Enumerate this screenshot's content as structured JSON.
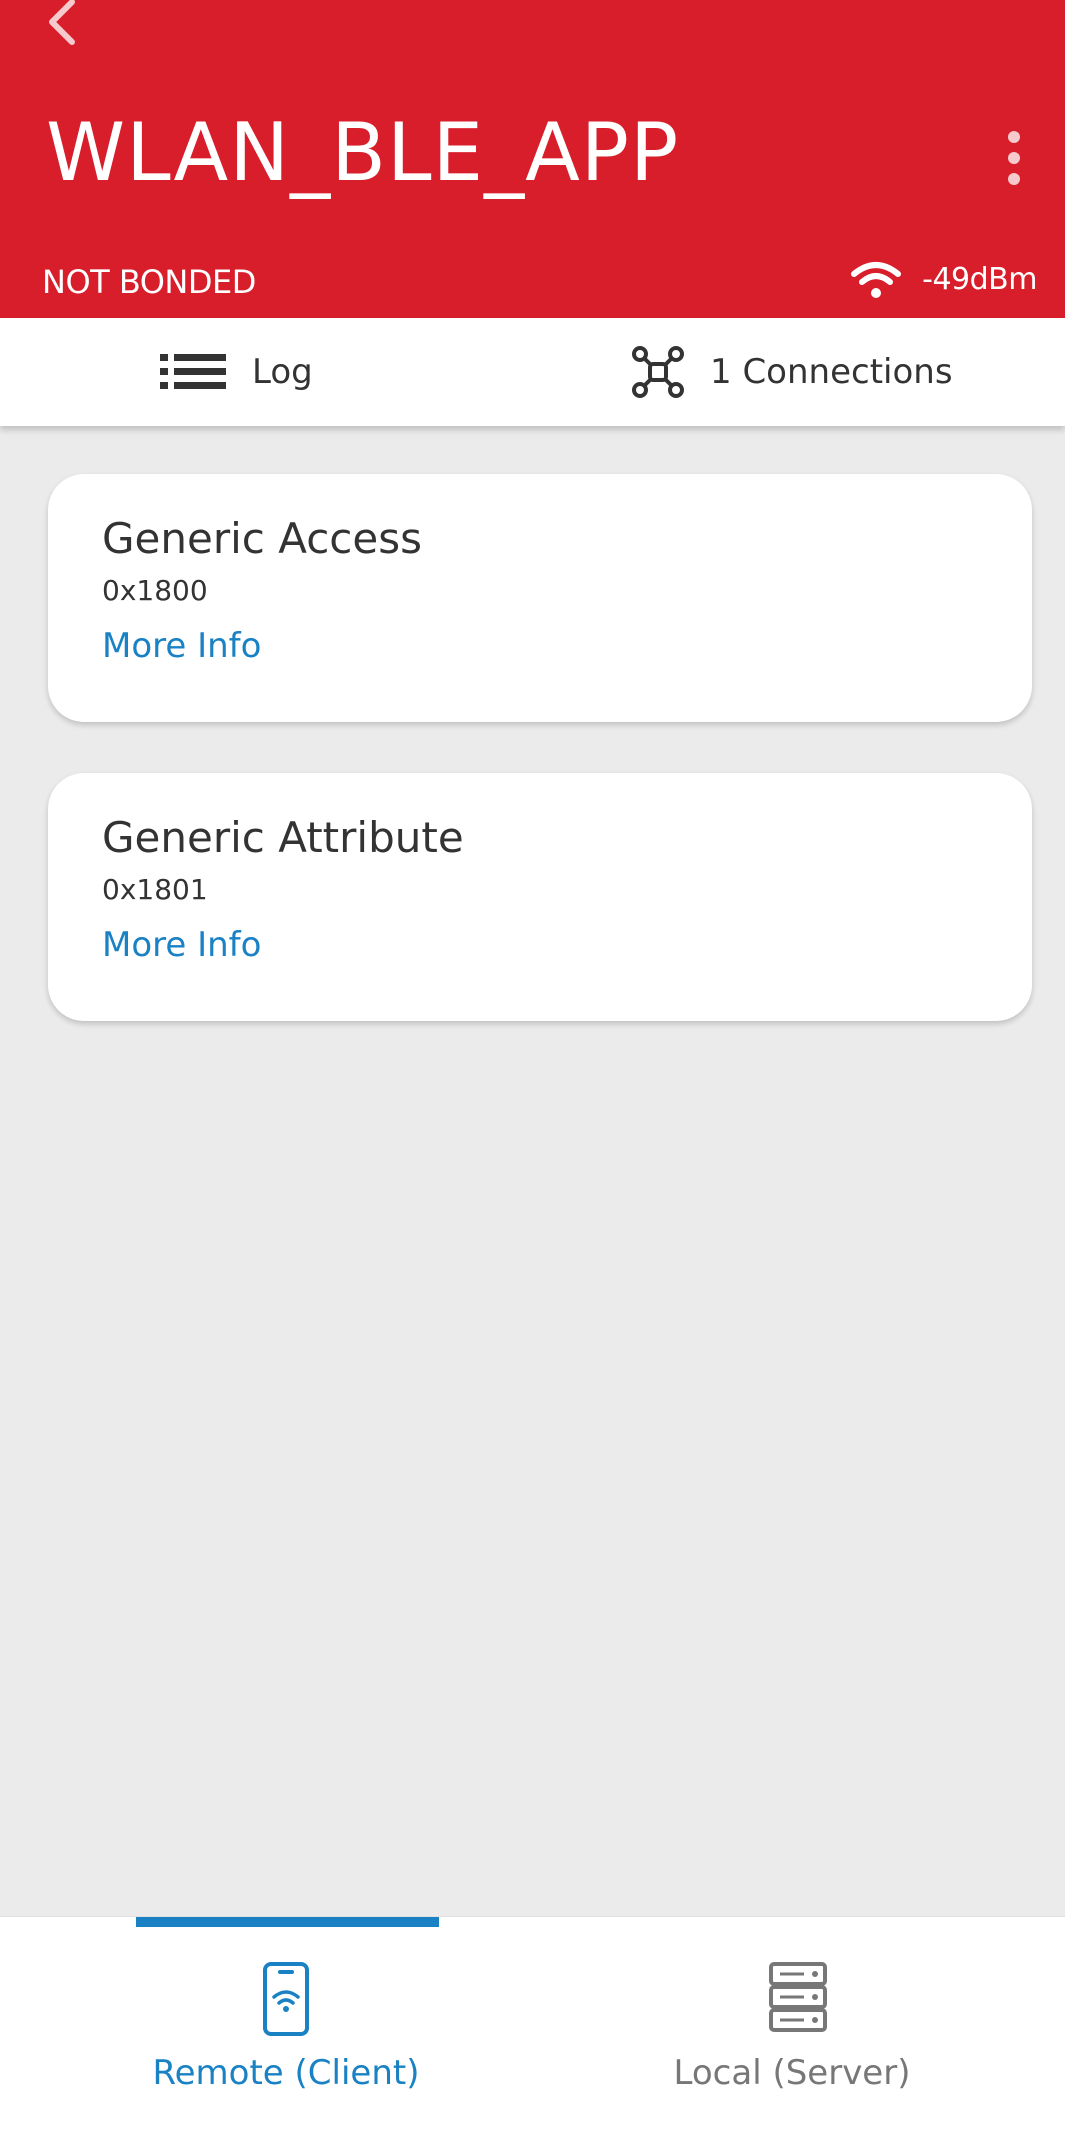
{
  "app_bar": {
    "title": "WLAN_BLE_APP",
    "bond_status": "NOT BONDED",
    "rssi": "-49dBm",
    "back_icon": "chevron-left-icon",
    "menu_icon": "more-vertical-icon",
    "signal_icon": "wifi-icon",
    "background_color": "#d81e2b"
  },
  "tabs": {
    "log": {
      "label": "Log",
      "icon": "list-icon"
    },
    "connections": {
      "label": "1 Connections",
      "icon": "network-icon"
    }
  },
  "services": [
    {
      "name": "Generic Access",
      "uuid": "0x1800",
      "more_label": "More Info"
    },
    {
      "name": "Generic Attribute",
      "uuid": "0x1801",
      "more_label": "More Info"
    }
  ],
  "bottom_nav": {
    "items": [
      {
        "label": "Remote (Client)",
        "icon": "phone-wifi-icon",
        "selected": true
      },
      {
        "label": "Local (Server)",
        "icon": "server-icon",
        "selected": false
      }
    ],
    "accent_color": "#1a82c4"
  }
}
